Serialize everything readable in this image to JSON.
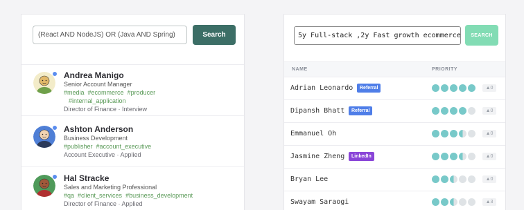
{
  "left": {
    "search_query": "(React AND NodeJS) OR (Java AND Spring)",
    "search_label": "Search",
    "candidates": [
      {
        "name": "Andrea Manigo",
        "title": "Senior Account Manager",
        "tags_line1": [
          "#media",
          "#ecommerce",
          "#producer"
        ],
        "tags_line2": [
          "#internal_application"
        ],
        "meta": "Director of Finance · Interview",
        "avatar_bg": "#f3ecc9",
        "skin": "#e2b96a",
        "shirt": "#6fa04a"
      },
      {
        "name": "Ashton Anderson",
        "title": "Business Development",
        "tags_line1": [
          "#publisher",
          "#account_executive"
        ],
        "tags_line2": [],
        "meta": "Account Executive · Applied",
        "avatar_bg": "#4f7fd6",
        "skin": "#f0d3b2",
        "shirt": "#2b3a5a"
      },
      {
        "name": "Hal Stracke",
        "title": "Sales and Marketing Professional",
        "tags_line1": [
          "#qa",
          "#client_services",
          "#business_development"
        ],
        "tags_line2": [],
        "meta": "Director of Finance · Applied",
        "avatar_bg": "#4f9a5a",
        "skin": "#a0593a",
        "shirt": "#b03030"
      }
    ]
  },
  "right": {
    "search_query": "5y Full-stack ,2y Fast growth ecommerce",
    "search_label": "SEARCH",
    "col_name": "NAME",
    "col_priority": "PRIORITY",
    "rows": [
      {
        "name": "Adrian Leonardo",
        "badge": "Referral",
        "badge_color": "#4f7ee8",
        "priority": 5,
        "count": "▲0"
      },
      {
        "name": "Dipansh Bhatt",
        "badge": "Referral",
        "badge_color": "#4f7ee8",
        "priority": 4,
        "count": "▲0"
      },
      {
        "name": "Emmanuel Oh",
        "badge": "",
        "badge_color": "",
        "priority": 3.5,
        "count": "▲0"
      },
      {
        "name": "Jasmine Zheng",
        "badge": "LinkedIn",
        "badge_color": "#8a45d8",
        "priority": 3.5,
        "count": "▲0"
      },
      {
        "name": "Bryan Lee",
        "badge": "",
        "badge_color": "",
        "priority": 2.5,
        "count": "▲0"
      },
      {
        "name": "Swayam Saraogi",
        "badge": "",
        "badge_color": "",
        "priority": 2.5,
        "count": "▲3"
      }
    ],
    "dot_color": "#78c9c9",
    "dot_empty_color": "#dfe3e6"
  }
}
